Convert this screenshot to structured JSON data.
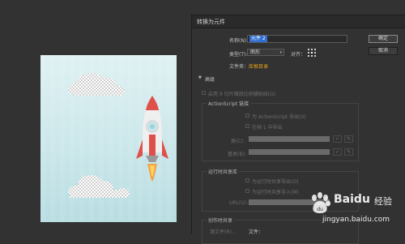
{
  "dialog": {
    "title": "转换为元件",
    "name_label": "名称(N):",
    "name_value": "元件 2",
    "type_label": "类型(T):",
    "type_value": "图形",
    "align_label": "对齐：",
    "folder_label": "文件夹：",
    "folder_value": "库根目录",
    "advanced_label": "高级",
    "option_9slice": "启用 9 切片缩放比例辅助线(G)",
    "ok_label": "确定",
    "cancel_label": "取消"
  },
  "actionscript": {
    "title": "ActionScript 链接",
    "export_as": "为 ActionScript 导出(X)",
    "export_frame1": "在帧 1 中导出",
    "class_label": "类(C):",
    "base_class_label": "基类(B):"
  },
  "runtime": {
    "title": "运行时共享库",
    "export_runtime": "为运行时共享导出(O)",
    "import_runtime": "为运行时共享导入(M)",
    "url_label": "URL(U):"
  },
  "authortime": {
    "title": "创作时共享",
    "file_label": "文件：",
    "source_label": "源文件(R)..."
  },
  "watermark": {
    "brand": "Baidu",
    "brand_cn": "经验",
    "url": "jingyan.baidu.com"
  },
  "icons": [
    "dropdown-icon",
    "align-grid-icon",
    "collapse-triangle-icon",
    "pencil-icon",
    "pin-icon",
    "baidu-paw-icon",
    "rocket-illustration",
    "cloud-illustration"
  ]
}
